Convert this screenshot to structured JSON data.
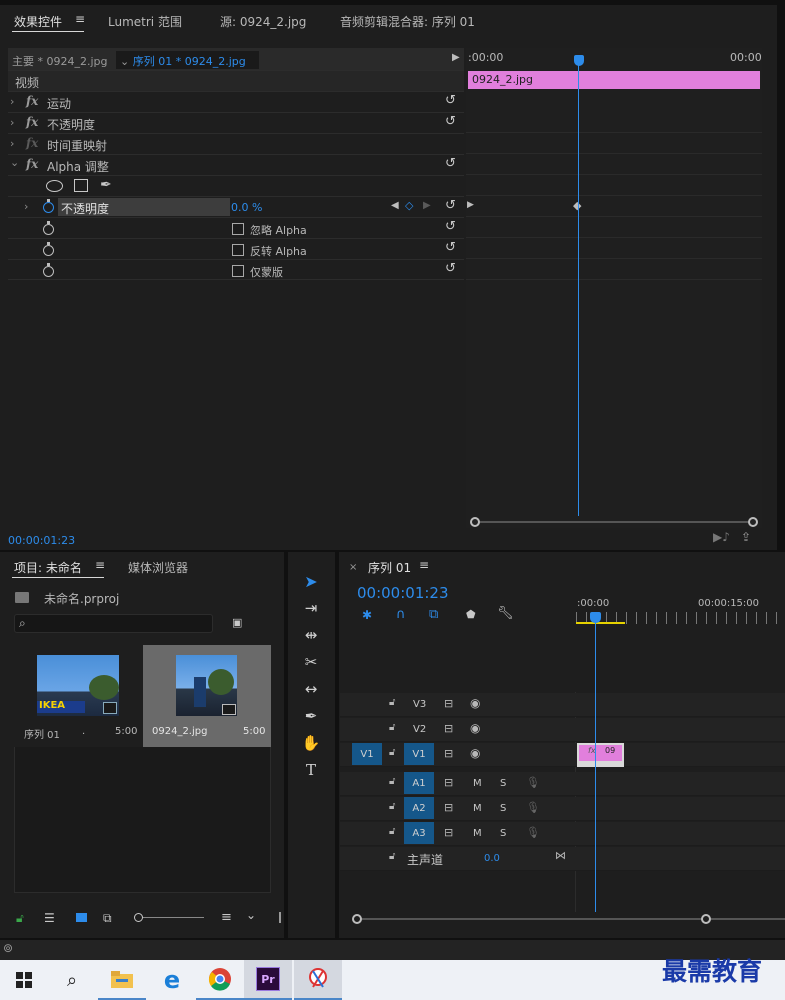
{
  "effects_panel": {
    "tabs": [
      "效果控件",
      "Lumetri 范围",
      "源: 0924_2.jpg",
      "音频剪辑混合器: 序列 01"
    ],
    "master_label": "主要 * 0924_2.jpg",
    "sequence_label": "序列 01 * 0924_2.jpg",
    "ruler_start": ":00:00",
    "ruler_end": "00:00",
    "clip_name": "0924_2.jpg",
    "section_video": "视频",
    "effects": [
      "运动",
      "不透明度",
      "时间重映射",
      "Alpha 调整"
    ],
    "opacity_label": "不透明度",
    "opacity_value": "0.0 %",
    "checkbox_labels": [
      "忽略 Alpha",
      "反转 Alpha",
      "仅蒙版"
    ],
    "timecode": "00:00:01:23"
  },
  "project_panel": {
    "tabs": [
      "项目: 未命名",
      "媒体浏览器"
    ],
    "project_file": "未命名.prproj",
    "search_placeholder": "",
    "items": [
      {
        "name": "序列 01",
        "dot": ".",
        "duration": "5:00"
      },
      {
        "name": "0924_2.jpg",
        "dot": "",
        "duration": "5:00"
      }
    ]
  },
  "timeline": {
    "tab": "序列 01",
    "timecode": "00:00:01:23",
    "ruler_labels": [
      ":00:00",
      "00:00:15:00"
    ],
    "video_tracks": [
      "V3",
      "V2",
      "V1"
    ],
    "source_patch": "V1",
    "audio_tracks": [
      "A1",
      "A2",
      "A3"
    ],
    "mute": "M",
    "solo": "S",
    "master_label": "主声道",
    "master_value": "0.0",
    "clip_label": "09",
    "clip_fx": "fx"
  },
  "watermark": "最需教育",
  "colors": {
    "accent": "#2d8ceb",
    "clip_pink": "#e17fdc",
    "track_blue": "#15578a"
  }
}
